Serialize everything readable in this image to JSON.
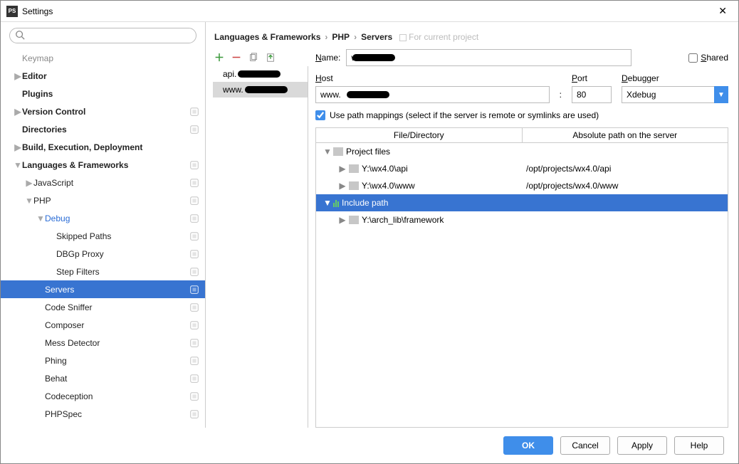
{
  "window": {
    "title": "Settings"
  },
  "breadcrumb": {
    "a": "Languages & Frameworks",
    "b": "PHP",
    "c": "Servers",
    "hint": "For current project"
  },
  "sidebar": {
    "items": [
      {
        "label": "Keymap",
        "indent": 0,
        "arrow": "",
        "bold": false,
        "badge": false,
        "alt": true
      },
      {
        "label": "Editor",
        "indent": 0,
        "arrow": "▶",
        "bold": true,
        "badge": false
      },
      {
        "label": "Plugins",
        "indent": 0,
        "arrow": "",
        "bold": true,
        "badge": false
      },
      {
        "label": "Version Control",
        "indent": 0,
        "arrow": "▶",
        "bold": true,
        "badge": true
      },
      {
        "label": "Directories",
        "indent": 0,
        "arrow": "",
        "bold": true,
        "badge": true
      },
      {
        "label": "Build, Execution, Deployment",
        "indent": 0,
        "arrow": "▶",
        "bold": true,
        "badge": false
      },
      {
        "label": "Languages & Frameworks",
        "indent": 0,
        "arrow": "▼",
        "bold": true,
        "badge": true
      },
      {
        "label": "JavaScript",
        "indent": 1,
        "arrow": "▶",
        "bold": false,
        "badge": true
      },
      {
        "label": "PHP",
        "indent": 1,
        "arrow": "▼",
        "bold": false,
        "badge": true
      },
      {
        "label": "Debug",
        "indent": 2,
        "arrow": "▼",
        "bold": false,
        "badge": true,
        "blue": true
      },
      {
        "label": "Skipped Paths",
        "indent": 3,
        "arrow": "",
        "bold": false,
        "badge": true
      },
      {
        "label": "DBGp Proxy",
        "indent": 3,
        "arrow": "",
        "bold": false,
        "badge": true
      },
      {
        "label": "Step Filters",
        "indent": 3,
        "arrow": "",
        "bold": false,
        "badge": true
      },
      {
        "label": "Servers",
        "indent": 2,
        "arrow": "",
        "bold": false,
        "badge": true,
        "selected": true
      },
      {
        "label": "Code Sniffer",
        "indent": 2,
        "arrow": "",
        "bold": false,
        "badge": true
      },
      {
        "label": "Composer",
        "indent": 2,
        "arrow": "",
        "bold": false,
        "badge": true
      },
      {
        "label": "Mess Detector",
        "indent": 2,
        "arrow": "",
        "bold": false,
        "badge": true
      },
      {
        "label": "Phing",
        "indent": 2,
        "arrow": "",
        "bold": false,
        "badge": true
      },
      {
        "label": "Behat",
        "indent": 2,
        "arrow": "",
        "bold": false,
        "badge": true
      },
      {
        "label": "Codeception",
        "indent": 2,
        "arrow": "",
        "bold": false,
        "badge": true
      },
      {
        "label": "PHPSpec",
        "indent": 2,
        "arrow": "",
        "bold": false,
        "badge": true
      }
    ]
  },
  "servers": {
    "list": [
      {
        "prefix": "api.",
        "selected": false
      },
      {
        "prefix": "www.",
        "selected": true
      }
    ]
  },
  "form": {
    "name_label": "Name:",
    "name_value": "www.",
    "shared_label": "Shared",
    "host_label": "Host",
    "host_value": "www.",
    "port_label": "Port",
    "port_value": "80",
    "debugger_label": "Debugger",
    "debugger_value": "Xdebug",
    "use_mappings_label": "Use path mappings (select if the server is remote or symlinks are used)"
  },
  "mapping": {
    "head_a": "File/Directory",
    "head_b": "Absolute path on the server",
    "rows": [
      {
        "type": "root",
        "arrow": "▼",
        "label": "Project files",
        "abs": ""
      },
      {
        "type": "folder",
        "arrow": "▶",
        "label": "Y:\\wx4.0\\api",
        "abs": "/opt/projects/wx4.0/api"
      },
      {
        "type": "folder",
        "arrow": "▶",
        "label": "Y:\\wx4.0\\www",
        "abs": "/opt/projects/wx4.0/www"
      },
      {
        "type": "include",
        "arrow": "▼",
        "label": "Include path",
        "abs": "",
        "hlt": true
      },
      {
        "type": "folder",
        "arrow": "▶",
        "label": "Y:\\arch_lib\\framework",
        "abs": ""
      }
    ]
  },
  "footer": {
    "ok": "OK",
    "cancel": "Cancel",
    "apply": "Apply",
    "help": "Help"
  }
}
